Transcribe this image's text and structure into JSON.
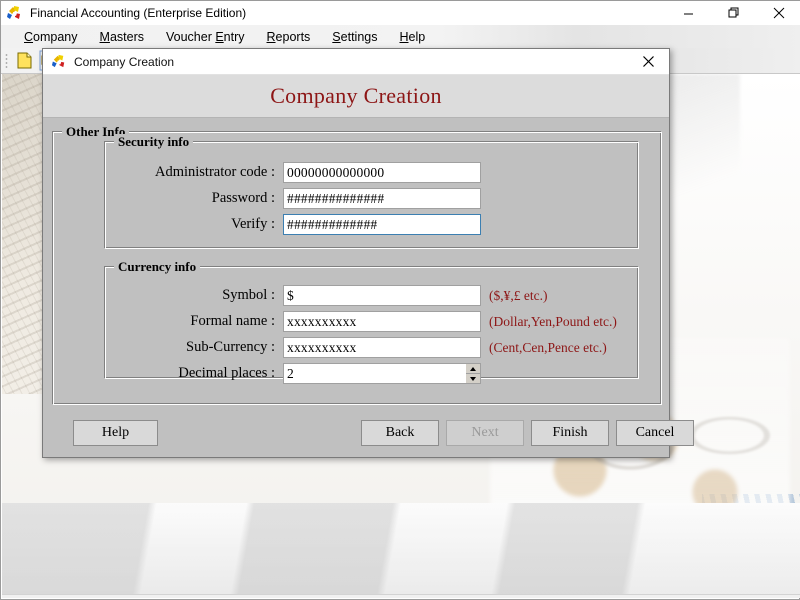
{
  "window": {
    "title": "Financial Accounting (Enterprise Edition)",
    "app_icon": "app-puzzle-icon",
    "controls": {
      "minimize": "minimize-icon",
      "restore": "restore-icon",
      "close": "close-icon"
    }
  },
  "menubar": {
    "items": [
      {
        "label": "Company",
        "accel": "C"
      },
      {
        "label": "Masters",
        "accel": "M"
      },
      {
        "label": "Voucher Entry",
        "accel": "E"
      },
      {
        "label": "Reports",
        "accel": "R"
      },
      {
        "label": "Settings",
        "accel": "S"
      },
      {
        "label": "Help",
        "accel": "H"
      }
    ]
  },
  "toolbar": {
    "buttons": [
      {
        "name": "new-document-icon"
      },
      {
        "name": "open-folder-icon"
      },
      {
        "name": "ledger-grid-icon"
      },
      {
        "name": "balance-scale-icon"
      },
      {
        "name": "diamond-voucher-icon"
      },
      {
        "name": "add-report-icon"
      }
    ]
  },
  "dialog": {
    "titlebar_text": "Company Creation",
    "icon": "app-puzzle-icon",
    "close_label": "✕",
    "heading": "Company Creation",
    "groups": {
      "other_info": {
        "label": "Other Info"
      },
      "security": {
        "label": "Security info",
        "fields": [
          {
            "label": "Administrator code :",
            "value": "00000000000000",
            "focused": false
          },
          {
            "label": "Password :",
            "value": "##############",
            "focused": false
          },
          {
            "label": "Verify :",
            "value": "#############",
            "focused": true
          }
        ]
      },
      "currency": {
        "label": "Currency info",
        "fields": [
          {
            "label": "Symbol :",
            "value": "$",
            "hint": "($,¥,£ etc.)"
          },
          {
            "label": "Formal name :",
            "value": "xxxxxxxxxx",
            "hint": "(Dollar,Yen,Pound etc.)"
          },
          {
            "label": "Sub-Currency :",
            "value": "xxxxxxxxxx",
            "hint": "(Cent,Cen,Pence etc.)"
          },
          {
            "label": "Decimal places :",
            "value": "2",
            "hint": ""
          }
        ]
      }
    },
    "buttons": [
      {
        "label": "Help",
        "name": "help-button",
        "disabled": false
      },
      {
        "label": "Back",
        "name": "back-button",
        "disabled": false
      },
      {
        "label": "Next",
        "name": "next-button",
        "disabled": true
      },
      {
        "label": "Finish",
        "name": "finish-button",
        "disabled": false
      },
      {
        "label": "Cancel",
        "name": "cancel-button",
        "disabled": false
      }
    ]
  },
  "colors": {
    "heading_red": "#8d1616",
    "hint_red": "#8d1616",
    "dialog_face": "#c0c0c0",
    "focus_border": "#3c7fb1"
  }
}
